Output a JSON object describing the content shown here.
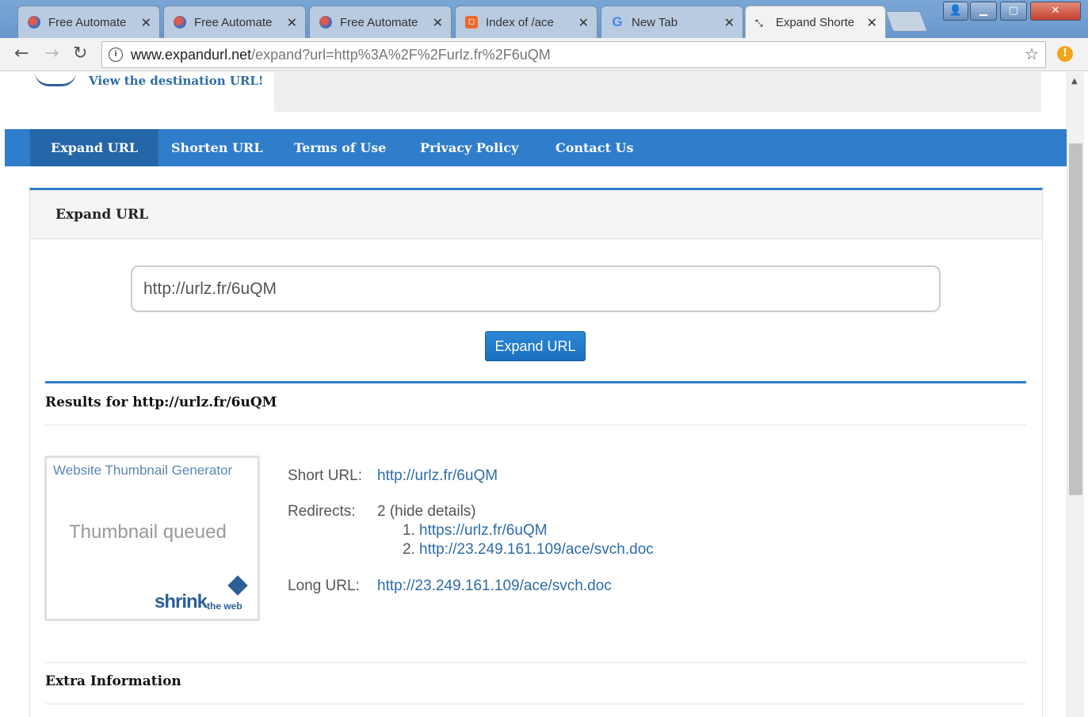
{
  "browser": {
    "tabs": [
      {
        "label": "Free Automate",
        "icon": "globe-icon"
      },
      {
        "label": "Free Automate",
        "icon": "globe-icon"
      },
      {
        "label": "Free Automate",
        "icon": "globe-icon"
      },
      {
        "label": "Index of /ace",
        "icon": "html-icon"
      },
      {
        "label": "New Tab",
        "icon": "google-icon"
      },
      {
        "label": "Expand Shorte",
        "icon": "expand-icon"
      }
    ],
    "url_host": "www.expandurl.net",
    "url_path": "/expand?url=http%3A%2F%2Furlz.fr%2F6uQM"
  },
  "site": {
    "tagline": "View the destination URL!",
    "nav": [
      "Expand URL",
      "Shorten URL",
      "Terms of Use",
      "Privacy Policy",
      "Contact Us"
    ]
  },
  "panel": {
    "title": "Expand URL",
    "input_value": "http://urlz.fr/6uQM",
    "button_label": "Expand URL"
  },
  "results": {
    "title": "Results for http://urlz.fr/6uQM",
    "thumbnail": {
      "title": "Website Thumbnail Generator",
      "status": "Thumbnail queued",
      "logo_main": "shrink",
      "logo_small": "the web"
    },
    "short_url_label": "Short URL:",
    "short_url": "http://urlz.fr/6uQM",
    "redirects_label": "Redirects:",
    "redirects_summary": "2 (hide details)",
    "redirects": [
      {
        "num": "1.",
        "url": "https://urlz.fr/6uQM"
      },
      {
        "num": "2.",
        "url": "http://23.249.161.109/ace/svch.doc"
      }
    ],
    "long_url_label": "Long URL:",
    "long_url": "http://23.249.161.109/ace/svch.doc"
  },
  "extra": {
    "title": "Extra Information"
  }
}
